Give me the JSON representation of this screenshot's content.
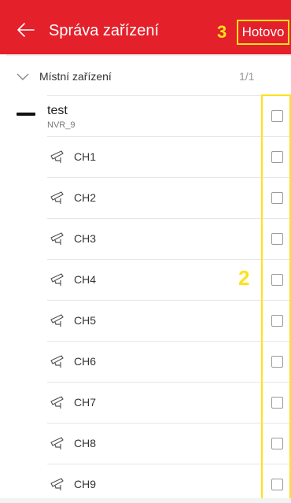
{
  "header": {
    "title": "Správa zařízení",
    "done_label": "Hotovo",
    "bg_color": "#e4202b"
  },
  "annotations": {
    "step_done": "3",
    "step_checkboxes": "2",
    "highlight_color": "#ffe11a"
  },
  "section": {
    "title": "Místní zařízení",
    "count": "1/1"
  },
  "device": {
    "name": "test",
    "subtitle": "NVR_9",
    "checked": false
  },
  "channels": [
    {
      "label": "CH1",
      "checked": false
    },
    {
      "label": "CH2",
      "checked": false
    },
    {
      "label": "CH3",
      "checked": false
    },
    {
      "label": "CH4",
      "checked": false
    },
    {
      "label": "CH5",
      "checked": false
    },
    {
      "label": "CH6",
      "checked": false
    },
    {
      "label": "CH7",
      "checked": false
    },
    {
      "label": "CH8",
      "checked": false
    },
    {
      "label": "CH9",
      "checked": false
    }
  ],
  "icons": {
    "back": "back-arrow-icon",
    "chevron": "chevron-down-icon",
    "device": "nvr-device-icon",
    "camera": "camera-icon"
  }
}
